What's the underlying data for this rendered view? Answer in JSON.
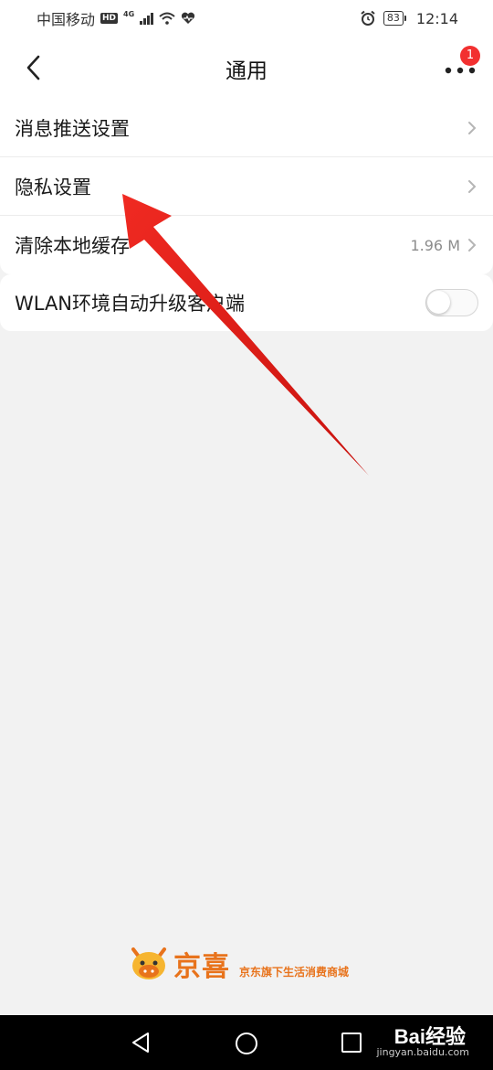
{
  "status_bar": {
    "carrier": "中国移动",
    "hd": "HD",
    "network": "4G",
    "battery": "83",
    "time": "12:14"
  },
  "nav": {
    "title": "通用",
    "badge_count": "1"
  },
  "settings": {
    "items": [
      {
        "label": "消息推送设置",
        "value": ""
      },
      {
        "label": "隐私设置",
        "value": ""
      },
      {
        "label": "清除本地缓存",
        "value": "1.96 M"
      }
    ],
    "wlan_toggle": {
      "label": "WLAN环境自动升级客户端",
      "on": false
    }
  },
  "brand": {
    "name": "京喜",
    "slogan": "京东旗下生活消费商城"
  },
  "watermark": {
    "text": "Bai经验",
    "url": "jingyan.baidu.com"
  },
  "colors": {
    "badge": "#f23030",
    "arrow": "#e8201c",
    "brand": "#e8731c"
  }
}
